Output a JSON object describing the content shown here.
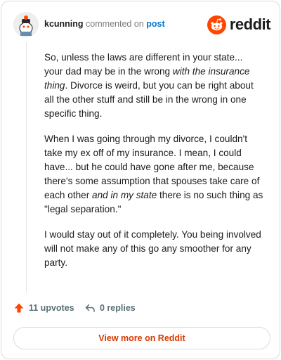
{
  "colors": {
    "brand": "#ff4500",
    "link": "#0079d3",
    "muted": "#7c7c7c",
    "footer_text": "#576f76",
    "view_more": "#d93900"
  },
  "header": {
    "username": "kcunning",
    "action_text": "commented on",
    "post_link_text": "post",
    "brand_wordmark": "reddit",
    "brand_icon": "reddit-snoo-icon",
    "avatar_icon": "user-avatar-icon"
  },
  "comment": {
    "p1_a": "So, unless the laws are different in your state... your dad may be in the wrong ",
    "p1_em": "with the insurance thing",
    "p1_b": ". Divorce is weird, but you can be right about all the other stuff and still be in the wrong in one specific thing.",
    "p2_a": "When I was going through my divorce, I couldn't take my ex off of my insurance. I mean, I could have... but he could have gone after me, because there's some assumption that spouses take care of each other ",
    "p2_em": "and in my state",
    "p2_b": " there is no such thing as \"legal separation.\"",
    "p3": "I would stay out of it completely. You being involved will not make any of this go any smoother for any party."
  },
  "footer": {
    "upvotes_label": "11 upvotes",
    "upvote_icon": "upvote-arrow-icon",
    "replies_label": "0 replies",
    "reply_icon": "reply-icon"
  },
  "cta": {
    "label": "View more on Reddit"
  }
}
